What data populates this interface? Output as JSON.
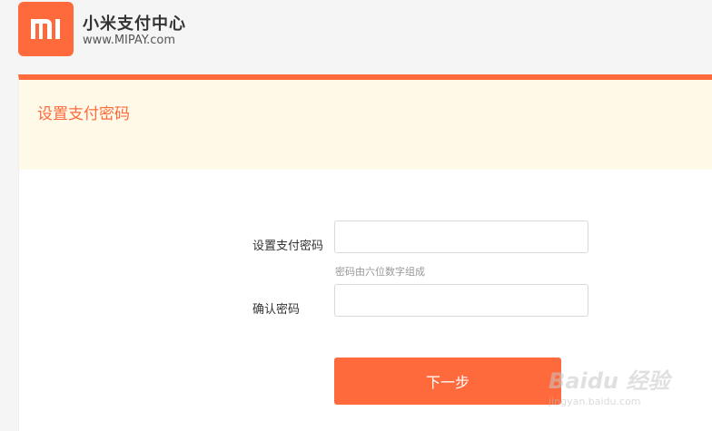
{
  "header": {
    "logo_text": "MI",
    "title": "小米支付中心",
    "url": "www.MIPAY.com"
  },
  "banner": {
    "title": "设置支付密码"
  },
  "form": {
    "password_label": "设置支付密码",
    "password_value": "",
    "password_hint": "密码由六位数字组成",
    "confirm_label": "确认密码",
    "confirm_value": "",
    "next_button_label": "下一步"
  },
  "watermark": {
    "main": "Baidu 经验",
    "sub": "jingyan.baidu.com"
  },
  "colors": {
    "accent": "#ff6a3d",
    "banner_bg": "#fffae8",
    "page_bg": "#f5f5f5"
  }
}
